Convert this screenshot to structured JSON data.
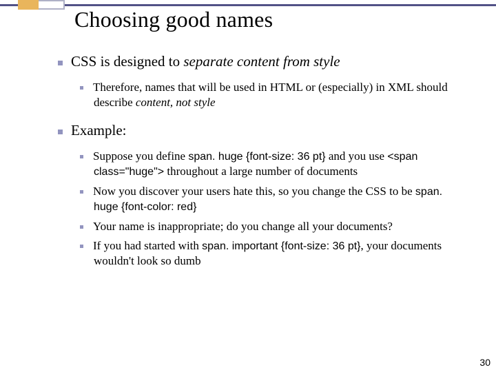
{
  "slide": {
    "title": "Choosing good names",
    "number": "30"
  },
  "points": {
    "p1": "CSS is designed to ",
    "p1_italic": "separate content from style",
    "p1a_a": "Therefore, names that will be used in HTML or (especially) in XML should describe ",
    "p1a_b": "content, not style",
    "p2": "Example:",
    "p2a_a": "Suppose you define ",
    "p2a_code1": "span. huge {font-size: 36 pt}",
    "p2a_b": " and you use ",
    "p2a_code2": "<span class=\"huge\">",
    "p2a_c": " throughout a large number of documents",
    "p2b_a": "Now you discover your users hate this, so you change the CSS to be ",
    "p2b_code": "span. huge {font-color: red}",
    "p2c": "Your name is inappropriate; do you change all your documents?",
    "p2d_a": "If you had started with ",
    "p2d_code": "span. important {font-size: 36 pt}",
    "p2d_b": ", your documents wouldn't look so dumb"
  }
}
